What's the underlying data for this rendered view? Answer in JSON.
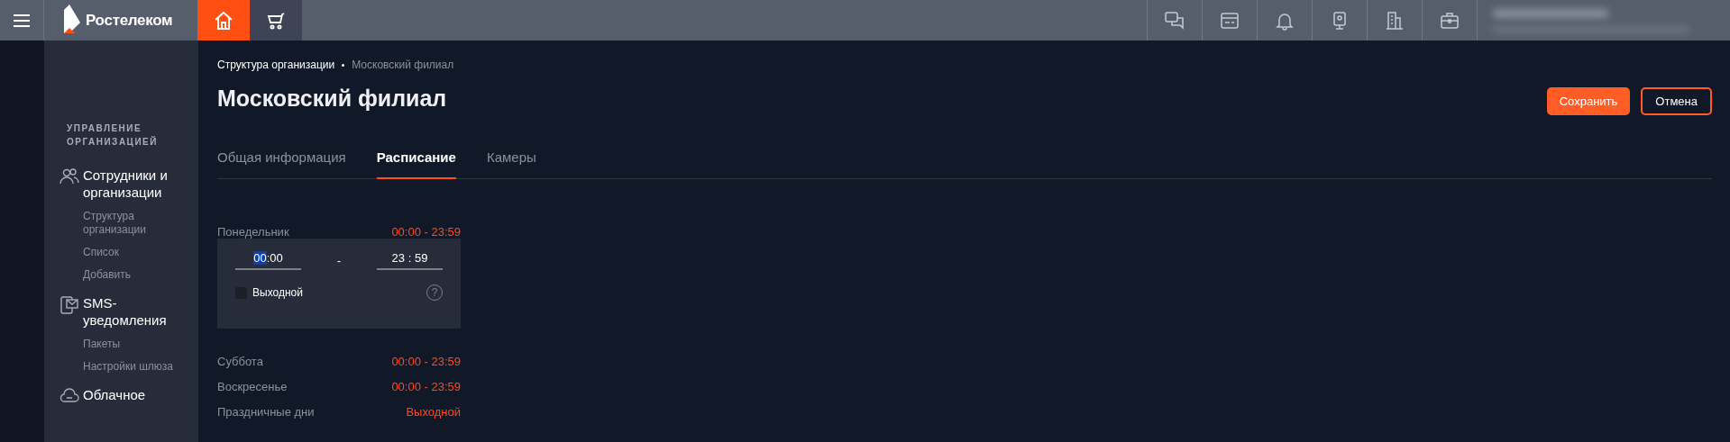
{
  "topbar": {
    "logo_text": "Ростелеком",
    "nav": [
      {
        "kind": "home",
        "selected": true
      },
      {
        "kind": "cart",
        "selected": false
      }
    ],
    "actions": [
      {
        "kind": "chat"
      },
      {
        "kind": "card"
      },
      {
        "kind": "bell"
      },
      {
        "kind": "camera"
      },
      {
        "kind": "building"
      },
      {
        "kind": "briefcase"
      }
    ]
  },
  "sidebar": {
    "heading": "УПРАВЛЕНИЕ ОРГАНИЗАЦИЕЙ",
    "sections": [
      {
        "label": "Сотрудники и организации",
        "items": [
          "Структура организации",
          "Список",
          "Добавить"
        ]
      },
      {
        "label": "SMS-уведомления",
        "items": [
          "Пакеты",
          "Настройки шлюза"
        ]
      },
      {
        "label": "Облачное"
      }
    ]
  },
  "breadcrumb": [
    {
      "label": "Структура организации",
      "current": false
    },
    {
      "label": "Московский филиал",
      "current": true
    }
  ],
  "title": "Московский филиал",
  "buttons": [
    {
      "label": "Сохранить",
      "kind": "primary"
    },
    {
      "label": "Отмена",
      "kind": "outline"
    }
  ],
  "tabs": [
    {
      "label": "Общая информация",
      "selected": false
    },
    {
      "label": "Расписание",
      "selected": true
    },
    {
      "label": "Камеры",
      "selected": false
    }
  ],
  "schedule": {
    "rows": [
      {
        "day": "Понедельник",
        "value": "00:00 - 23:59"
      }
    ],
    "editor": {
      "from_h": "00",
      "from_m": ":00",
      "sep": "-",
      "to": "23 : 59",
      "dayoff_label": "Выходной",
      "dayoff": false,
      "help": "?"
    },
    "rows_after": [
      {
        "day": "Суббота",
        "value": "00:00 - 23:59"
      },
      {
        "day": "Воскресенье",
        "value": "00:00 - 23:59"
      },
      {
        "day": "Праздничные дни",
        "value": "Выходной"
      }
    ]
  }
}
